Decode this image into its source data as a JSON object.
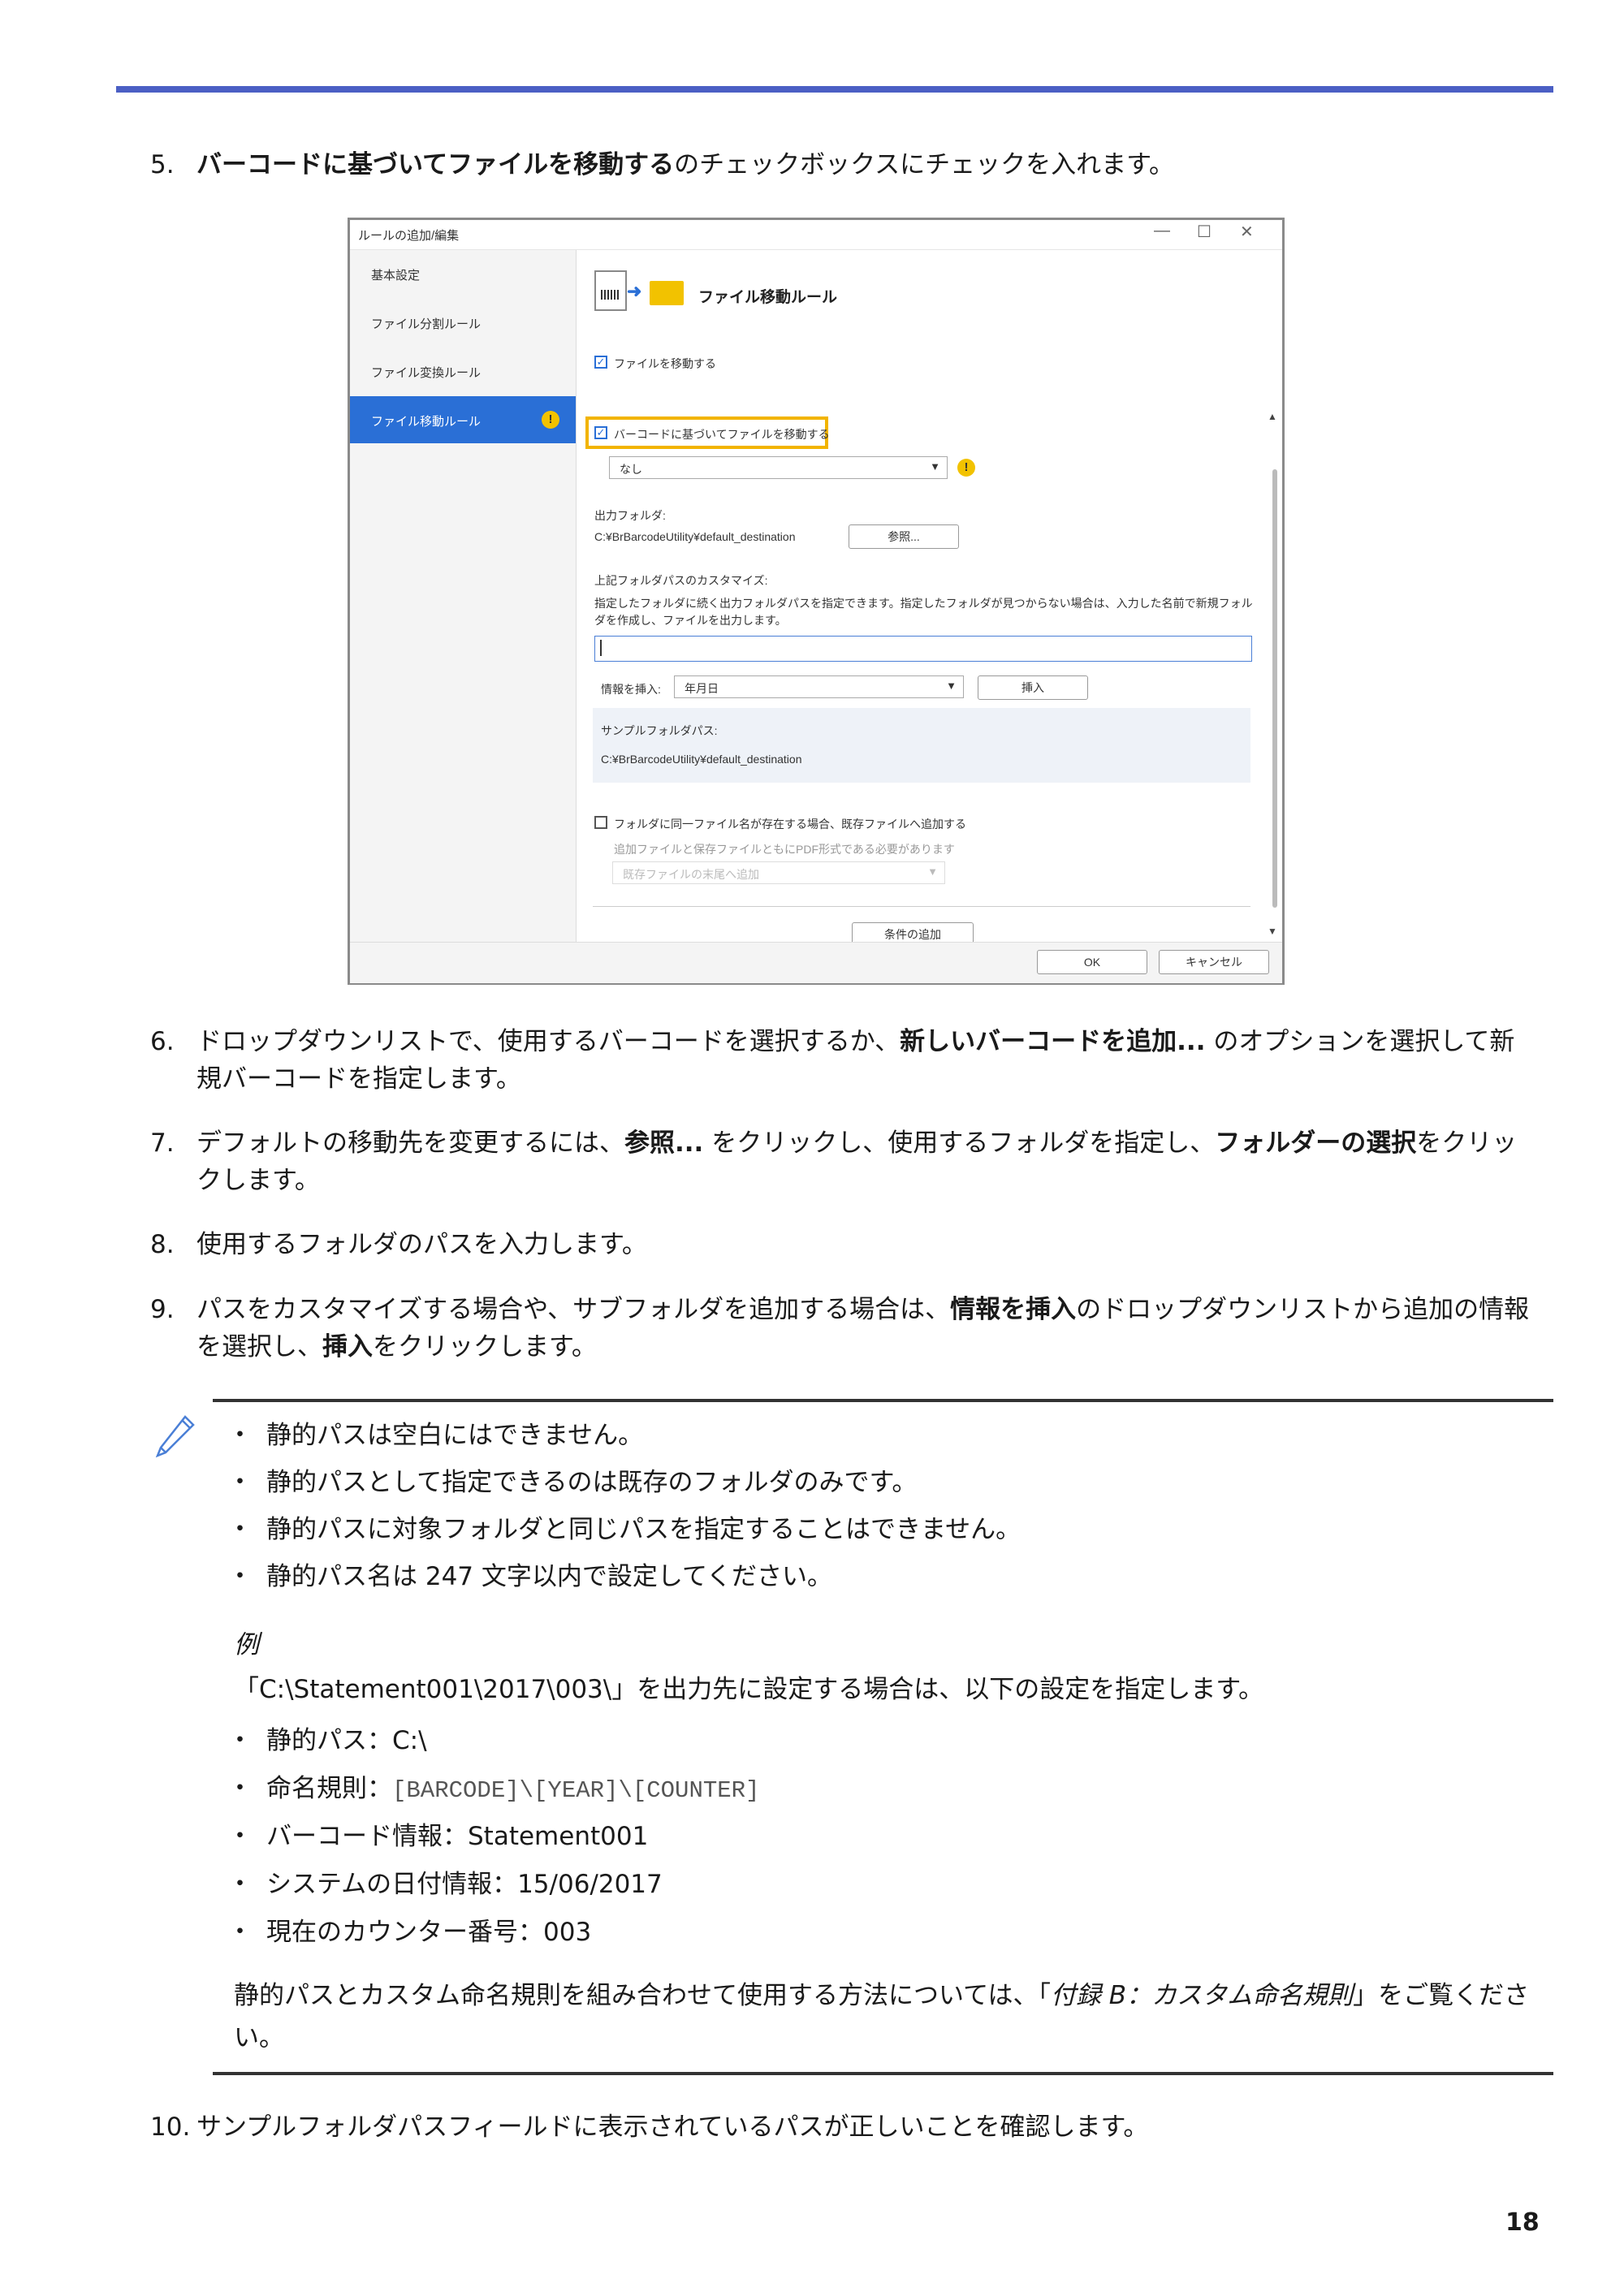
{
  "steps": {
    "s5": {
      "num": "5.",
      "bold": "バーコードに基づいてファイルを移動する",
      "rest": "のチェックボックスにチェックを入れます。"
    },
    "s6": {
      "num": "6.",
      "t1": "ドロップダウンリストで、使用するバーコードを選択するか、",
      "bold": "新しいバーコードを追加...",
      "t2": " のオプションを選択して新規バーコードを指定します。"
    },
    "s7": {
      "num": "7.",
      "t1": "デフォルトの移動先を変更するには、",
      "bold1": "参照...",
      "t2": " をクリックし、使用するフォルダを指定し、",
      "bold2": "フォルダーの選択",
      "t3": "をクリックします。"
    },
    "s8": {
      "num": "8.",
      "text": "使用するフォルダのパスを入力します。"
    },
    "s9": {
      "num": "9.",
      "t1": "パスをカスタマイズする場合や、サブフォルダを追加する場合は、",
      "bold1": "情報を挿入",
      "t2": "のドロップダウンリストから追加の情報を選択し、",
      "bold2": "挿入",
      "t3": "をクリックします。"
    },
    "s10": {
      "num": "10.",
      "text": "サンプルフォルダパスフィールドに表示されているパスが正しいことを確認します。"
    }
  },
  "dialog": {
    "title": "ルールの追加/編集",
    "min": "—",
    "max": "☐",
    "close": "✕",
    "sidebar": [
      "基本設定",
      "ファイル分割ルール",
      "ファイル変換ルール",
      "ファイル移動ルール"
    ],
    "warn_glyph": "!",
    "rule_title": "ファイル移動ルール",
    "move_files": "ファイルを移動する",
    "move_by_barcode": "バーコードに基づいてファイルを移動する",
    "barcode_select": "なし",
    "output_folder_label": "出力フォルダ:",
    "output_folder_path": "C:¥BrBarcodeUtility¥default_destination",
    "browse": "参照...",
    "customize_label": "上記フォルダパスのカスタマイズ:",
    "customize_desc": "指定したフォルダに続く出力フォルダパスを指定できます。指定したフォルダが見つからない場合は、入力した名前で新規フォルダを作成し、ファイルを出力します。",
    "insert_info_label": "情報を挿入:",
    "insert_info_value": "年月日",
    "insert_btn": "挿入",
    "sample_label": "サンプルフォルダパス:",
    "sample_path": "C:¥BrBarcodeUtility¥default_destination",
    "append_label": "フォルダに同一ファイル名が存在する場合、既存ファイルへ追加する",
    "append_note": "追加ファイルと保存ファイルともにPDF形式である必要があります",
    "append_select": "既存ファイルの末尾へ追加",
    "add_condition": "条件の追加",
    "ok": "OK",
    "cancel": "キャンセル",
    "check": "✓"
  },
  "note": {
    "bullets": [
      "静的パスは空白にはできません。",
      "静的パスとして指定できるのは既存のフォルダのみです。",
      "静的パスに対象フォルダと同じパスを指定することはできません。",
      "静的パス名は 247 文字以内で設定してください。"
    ],
    "example_label": "例",
    "example_intro": "「C:\\Statement001\\2017\\003\\」を出力先に設定する場合は、以下の設定を指定します。",
    "ex_items": [
      {
        "k": "静的パス：",
        "v": "C:\\"
      },
      {
        "k": "命名規則：",
        "v": "[BARCODE]\\[YEAR]\\[COUNTER]"
      },
      {
        "k": "バーコード情報：",
        "v": "Statement001"
      },
      {
        "k": "システムの日付情報：",
        "v": "15/06/2017"
      },
      {
        "k": "現在のカウンター番号：",
        "v": "003"
      }
    ],
    "closing_t1": "静的パスとカスタム命名規則を組み合わせて使用する方法については、「",
    "closing_it": "付録 B：カスタム命名規則",
    "closing_t2": "」をご覧ください。",
    "bullet_glyph": "・"
  },
  "page_number": "18"
}
